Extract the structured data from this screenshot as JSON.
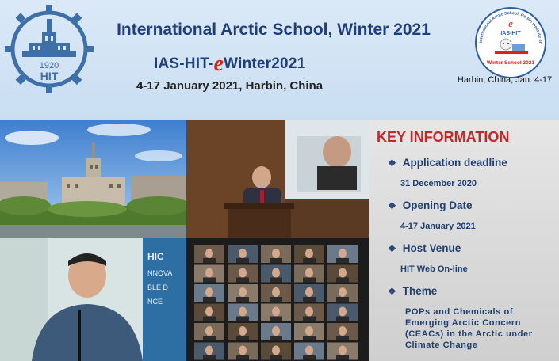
{
  "header": {
    "title": "International Arctic School, Winter 2021",
    "subtitle_prefix": "IAS-HIT-",
    "subtitle_e": "e",
    "subtitle_suffix": "Winter2021",
    "dates": "4-17 January 2021, Harbin, China",
    "hit_logo": {
      "year": "1920",
      "abbr": "HIT"
    },
    "winter_logo": {
      "ring_text": "International Arctic School, Harbin Institute of Technology",
      "e": "e",
      "name": "IAS-HIT",
      "banner": "Winter School 2021"
    },
    "logo_caption": "Harbin, China, Jan. 4-17"
  },
  "photos": {
    "campus": "campus-building-photo",
    "lecture": "lecture-speaker-photo",
    "speaker": "online-speaker-photo",
    "zoom": "video-conference-grid"
  },
  "key_info": {
    "title": "KEY INFORMATION",
    "items": [
      {
        "heading": "Application deadline",
        "value": "31 December 2020"
      },
      {
        "heading": "Opening Date",
        "value": "4-17 January 2021"
      },
      {
        "heading": "Host Venue",
        "value": "HIT Web On-line"
      }
    ],
    "theme_heading": "Theme",
    "theme_text": "POPs and Chemicals of Emerging Arctic Concern (CEACs) in the Arctic under Climate Change"
  },
  "colors": {
    "title": "#1f3f7a",
    "accent_red": "#c0282a",
    "panel": "#d9d9d9"
  }
}
